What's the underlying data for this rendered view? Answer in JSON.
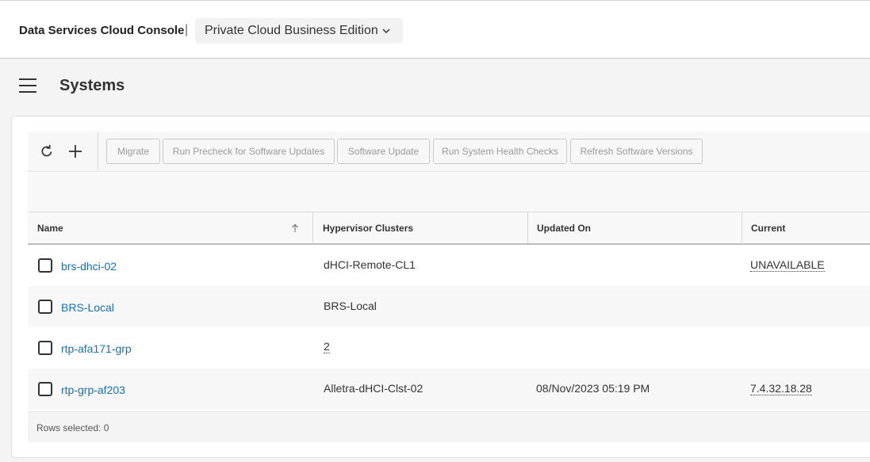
{
  "header": {
    "brand": "Data Services Cloud Console",
    "separator": "|",
    "edition": "Private Cloud Business Edition",
    "edition_icon": "chevron-down-icon"
  },
  "page": {
    "title": "Systems",
    "menu_icon": "hamburger-menu-icon"
  },
  "toolbar": {
    "refresh_icon": "refresh-icon",
    "add_icon": "plus-icon",
    "buttons": [
      "Migrate",
      "Run Precheck for Software Updates",
      "Software Update",
      "Run System Health Checks",
      "Refresh Software Versions"
    ]
  },
  "table": {
    "columns": [
      "Name",
      "Hypervisor Clusters",
      "Updated On",
      "Current"
    ],
    "sort": {
      "column": "Name",
      "direction": "ascending",
      "icon": "arrow-up-icon"
    },
    "rows": [
      {
        "name": "brs-dhci-02",
        "clusters": "dHCI-Remote-CL1",
        "updated": "",
        "current": "UNAVAILABLE"
      },
      {
        "name": "BRS-Local",
        "clusters": "BRS-Local",
        "updated": "",
        "current": ""
      },
      {
        "name": "rtp-afa171-grp",
        "clusters": "2",
        "updated": "",
        "current": ""
      },
      {
        "name": "rtp-grp-af203",
        "clusters": "Alletra-dHCI-Clst-02",
        "updated": "08/Nov/2023 05:19 PM",
        "current": "7.4.32.18.28"
      }
    ]
  },
  "footer": {
    "rows_selected": "Rows selected: 0"
  },
  "colors": {
    "link": "#1a6fb3",
    "header_bg": "#ffffff",
    "page_bg": "#f4f4f4",
    "row_alt": "#f7f7f7"
  }
}
